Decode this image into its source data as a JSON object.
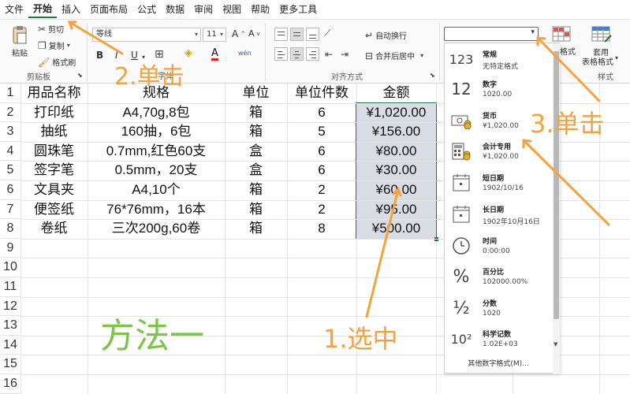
{
  "menubar": {
    "items": [
      "文件",
      "开始",
      "插入",
      "页面布局",
      "公式",
      "数据",
      "审阅",
      "视图",
      "帮助",
      "更多工具"
    ],
    "active_index": 1
  },
  "ribbon": {
    "clipboard": {
      "paste": "粘贴",
      "cut": "剪切",
      "copy": "复制",
      "format_painter": "格式刷",
      "label": "剪贴板"
    },
    "font": {
      "name": "等线",
      "size": "11",
      "label": "字体",
      "bold": "B",
      "italic": "I",
      "underline": "U",
      "font_color": "A"
    },
    "alignment": {
      "wrap": "自动换行",
      "merge": "合并后居中",
      "label": "对齐方式"
    },
    "styles": {
      "cond_format": "格式",
      "table_format_1": "套用",
      "table_format_2": "表格格式",
      "label": "样式"
    },
    "number_format": {
      "value": ""
    }
  },
  "sheet": {
    "row_numbers": [
      "1",
      "2",
      "3",
      "4",
      "5",
      "6",
      "7",
      "8",
      "9",
      "10",
      "11",
      "12",
      "13",
      "14",
      "15",
      "16"
    ],
    "headers": [
      "用品名称",
      "规格",
      "单位",
      "单位件数",
      "金额"
    ],
    "rows": [
      [
        "打印纸",
        "A4,70g,8包",
        "箱",
        "6",
        "¥1,020.00"
      ],
      [
        "抽纸",
        "160抽，6包",
        "箱",
        "5",
        "¥156.00"
      ],
      [
        "圆珠笔",
        "0.7mm,红色60支",
        "盒",
        "6",
        "¥80.00"
      ],
      [
        "签字笔",
        "0.5mm，20支",
        "盒",
        "6",
        "¥30.00"
      ],
      [
        "文具夹",
        "A4,10个",
        "箱",
        "2",
        "¥60.00"
      ],
      [
        "便签纸",
        "76*76mm，16本",
        "箱",
        "2",
        "¥95.00"
      ],
      [
        "卷纸",
        "三次200g,60卷",
        "箱",
        "8",
        "¥500.00"
      ]
    ]
  },
  "dropdown": {
    "items": [
      {
        "icon": "123",
        "title": "常规",
        "sub": "无特定格式"
      },
      {
        "icon": "12",
        "title": "数字",
        "sub": "1020.00"
      },
      {
        "icon": "currency-icon",
        "title": "货币",
        "sub": "¥1,020.00"
      },
      {
        "icon": "accounting-icon",
        "title": "会计专用",
        "sub": "¥1,020.00"
      },
      {
        "icon": "calendar-icon",
        "title": "短日期",
        "sub": "1902/10/16"
      },
      {
        "icon": "calendar-icon",
        "title": "长日期",
        "sub": "1902年10月16日"
      },
      {
        "icon": "clock-icon",
        "title": "时间",
        "sub": "0:00:00"
      },
      {
        "icon": "%",
        "title": "百分比",
        "sub": "102000.00%"
      },
      {
        "icon": "½",
        "title": "分数",
        "sub": "1020"
      },
      {
        "icon": "10²",
        "title": "科学记数",
        "sub": "1.02E+03"
      }
    ],
    "footer": "其他数字格式(M)..."
  },
  "annotations": {
    "step1": "1.选中",
    "step2": "2.单击",
    "step3": "3.单击",
    "method": "方法一",
    "color": "#f4a23c",
    "method_color": "#7dc44a"
  },
  "colors": {
    "accent": "#217346",
    "selection": "#d9dde3"
  }
}
